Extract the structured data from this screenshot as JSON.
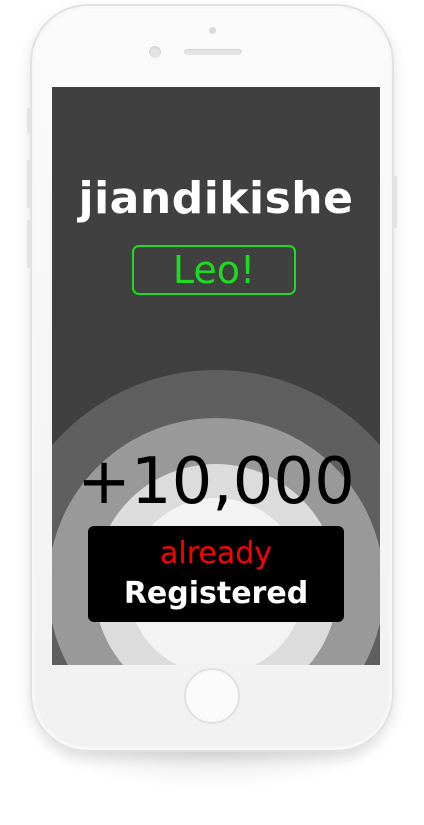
{
  "screen": {
    "brand": "jiandikishe",
    "name_tag": "Leo!",
    "user_count": "+10,000",
    "status_line1": "already",
    "status_line2": "Registered"
  },
  "colors": {
    "screen_bg": "#404040",
    "name_tag": "#1fdb1f",
    "status_line1": "#ff0000",
    "status_box": "#000000"
  },
  "device": {
    "type": "white-smartphone",
    "home_button": "home-button"
  }
}
